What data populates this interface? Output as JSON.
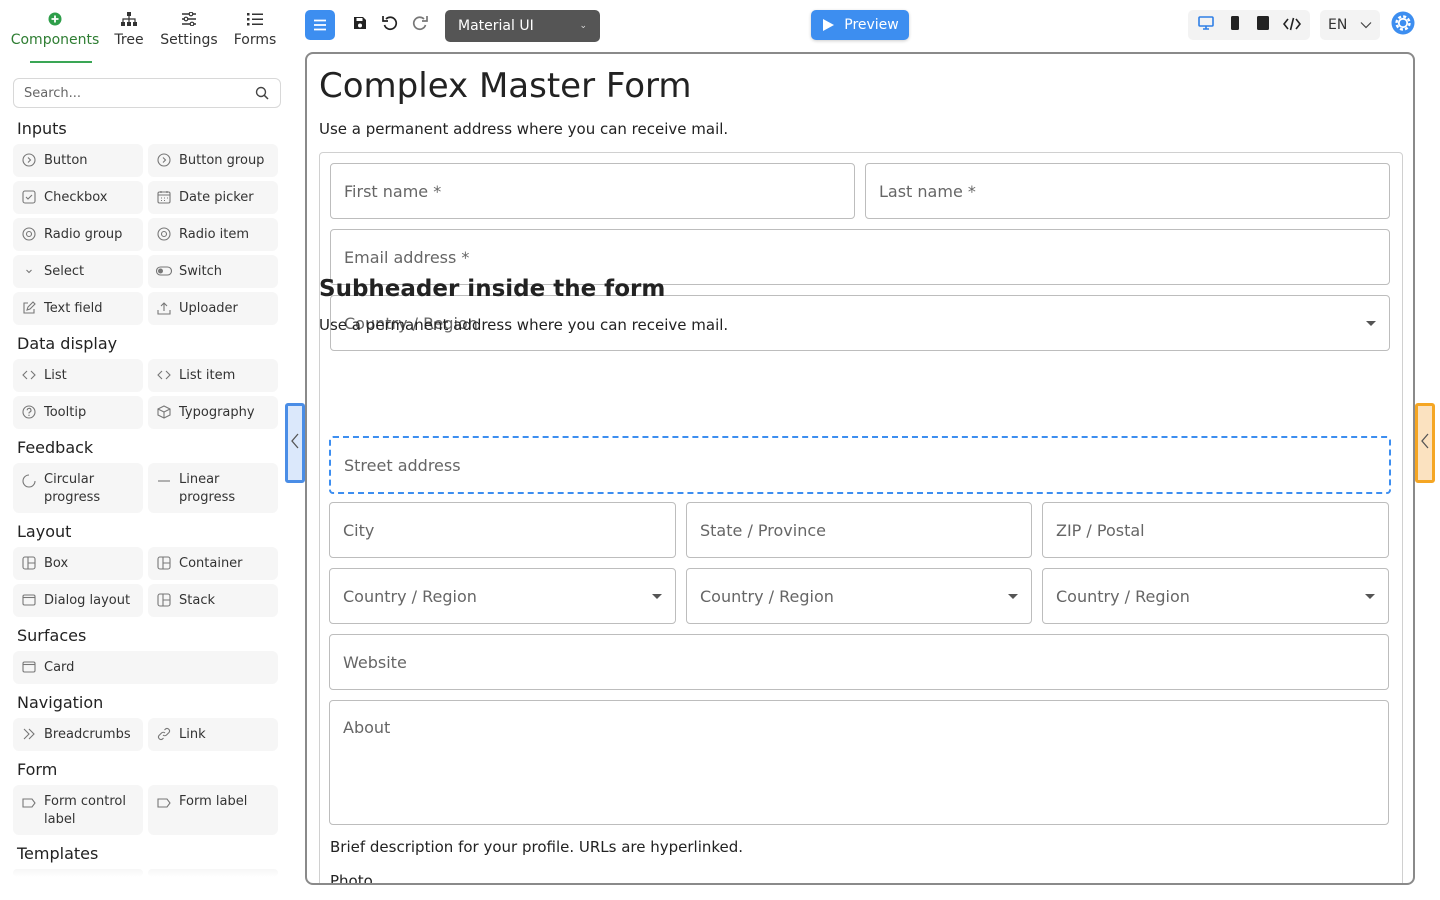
{
  "left_panel": {
    "tabs": [
      {
        "label": "Components",
        "icon": "plus-circle-icon"
      },
      {
        "label": "Tree",
        "icon": "tree-icon"
      },
      {
        "label": "Settings",
        "icon": "sliders-icon"
      },
      {
        "label": "Forms",
        "icon": "list-icon"
      }
    ],
    "search_placeholder": "Search...",
    "groups": [
      {
        "title": "Inputs",
        "items": [
          "Button",
          "Button group",
          "Checkbox",
          "Date picker",
          "Radio group",
          "Radio item",
          "Select",
          "Switch",
          "Text field",
          "Uploader"
        ]
      },
      {
        "title": "Data display",
        "items": [
          "List",
          "List item",
          "Tooltip",
          "Typography"
        ]
      },
      {
        "title": "Feedback",
        "items": [
          "Circular progress",
          "Linear progress"
        ]
      },
      {
        "title": "Layout",
        "items": [
          "Box",
          "Container",
          "Dialog layout",
          "Stack"
        ]
      },
      {
        "title": "Surfaces",
        "items": [
          "Card"
        ]
      },
      {
        "title": "Navigation",
        "items": [
          "Breadcrumbs",
          "Link"
        ]
      },
      {
        "title": "Form",
        "items": [
          "Form control label",
          "Form label"
        ]
      },
      {
        "title": "Templates",
        "items": []
      }
    ]
  },
  "toolbar": {
    "library": "Material UI",
    "preview_label": "Preview",
    "language": "EN"
  },
  "form": {
    "title": "Complex Master Form",
    "description": "Use a permanent address where you can receive mail.",
    "first_name": "First name *",
    "last_name": "Last name *",
    "email": "Email address *",
    "country": "Country / Region",
    "subheader": "Subheader inside the form",
    "sub_description": "Use a permanent address where you can receive mail.",
    "street": "Street address",
    "city": "City",
    "state": "State / Province",
    "zip": "ZIP / Postal",
    "country_a": "Country / Region",
    "country_b": "Country / Region",
    "country_c": "Country / Region",
    "website": "Website",
    "about": "About",
    "about_helper": "Brief description for your profile. URLs are hyperlinked.",
    "photo": "Photo"
  },
  "colors": {
    "accent_blue": "#3d8ef0",
    "active_green": "#2e7d32",
    "handle_orange": "#f5a623"
  }
}
